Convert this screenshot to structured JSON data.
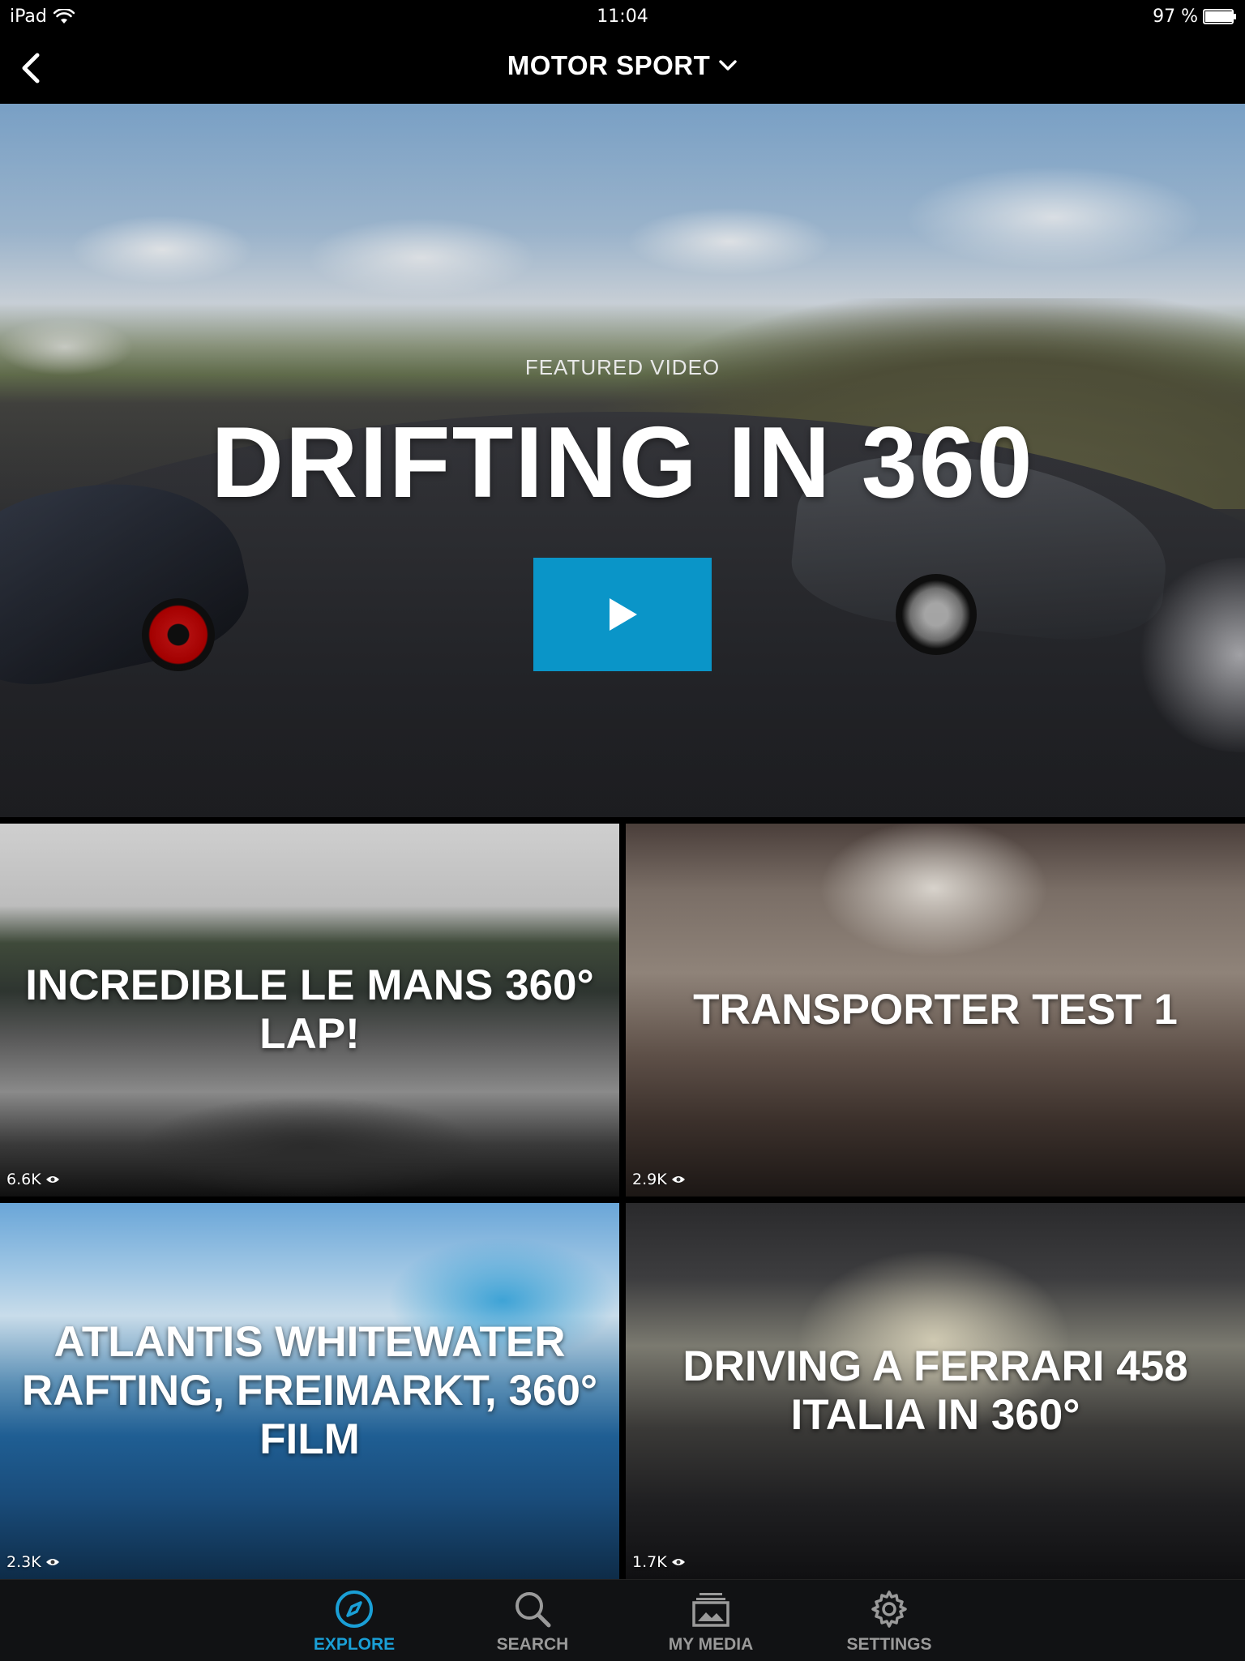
{
  "status_bar": {
    "device": "iPad",
    "time": "11:04",
    "battery": "97 %",
    "battery_level": 0.97
  },
  "nav": {
    "title": "MOTOR SPORT"
  },
  "hero": {
    "label": "FEATURED VIDEO",
    "title": "DRIFTING IN 360",
    "play_color": "#0a95c8"
  },
  "videos": [
    {
      "title": "INCREDIBLE LE MANS 360° LAP!",
      "views": "6.6K"
    },
    {
      "title": "TRANSPORTER TEST 1",
      "views": "2.9K"
    },
    {
      "title": "ATLANTIS WHITEWATER RAFTING, FREIMARKT, 360° FILM",
      "views": "2.3K"
    },
    {
      "title": "DRIVING A FERRARI 458 ITALIA IN 360°",
      "views": "1.7K"
    }
  ],
  "tabs": {
    "explore": "EXPLORE",
    "search": "SEARCH",
    "my_media": "MY MEDIA",
    "settings": "SETTINGS",
    "active": "explore",
    "active_color": "#1a9fd6"
  }
}
